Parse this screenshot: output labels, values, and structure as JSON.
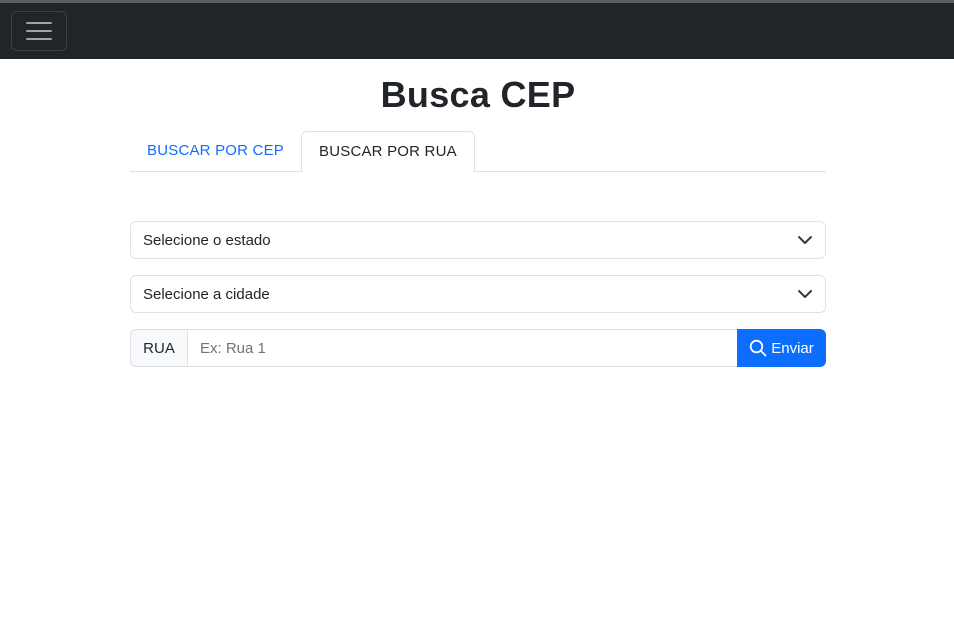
{
  "navbar": {
    "toggler_icon": "hamburger-icon"
  },
  "page": {
    "title": "Busca CEP"
  },
  "tabs": [
    {
      "label": "BUSCAR POR CEP",
      "active": false
    },
    {
      "label": "BUSCAR POR RUA",
      "active": true
    }
  ],
  "form": {
    "state_select": "Selecione o estado",
    "city_select": "Selecione a cidade",
    "street_addon": "RUA",
    "street_placeholder": "Ex: Rua 1",
    "street_value": "",
    "submit_label": "Enviar",
    "submit_icon": "search-icon"
  },
  "colors": {
    "navbar_bg": "#212529",
    "accent": "#0d6efd",
    "border": "#dee2e6"
  }
}
